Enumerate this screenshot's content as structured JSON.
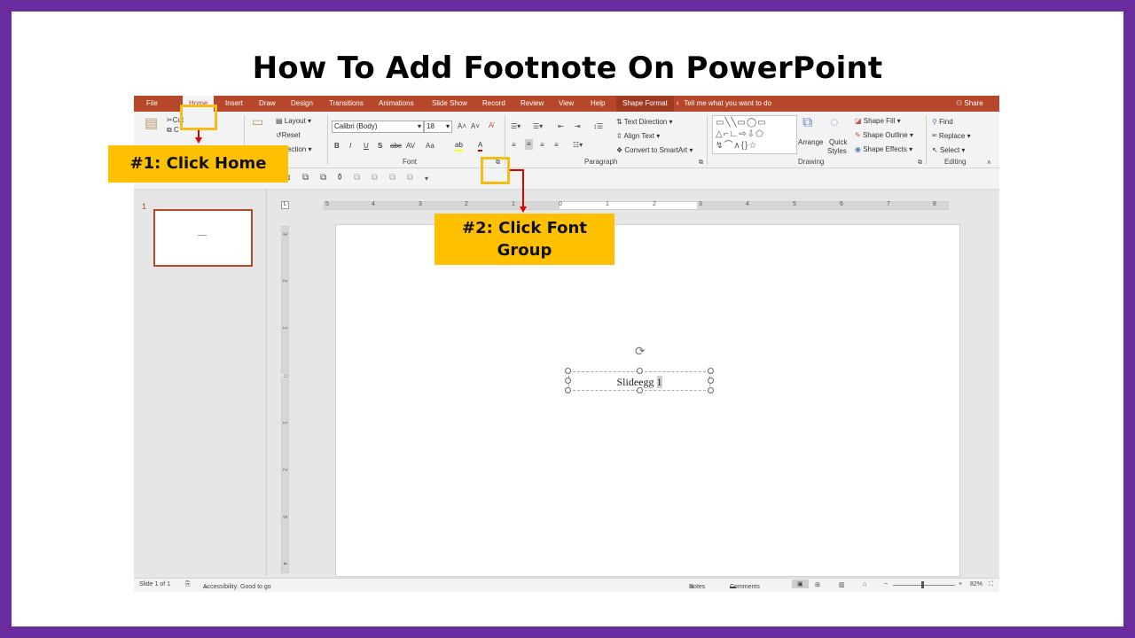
{
  "title": "How To Add Footnote On PowerPoint",
  "tabs": [
    "File",
    "Home",
    "Insert",
    "Draw",
    "Design",
    "Transitions",
    "Animations",
    "Slide Show",
    "Record",
    "Review",
    "View",
    "Help",
    "Shape Format"
  ],
  "tell_me": "Tell me what you want to do",
  "share": "Share",
  "clipboard": {
    "cut": "Cut",
    "copy": "C",
    "label": "es"
  },
  "slides_group": {
    "layout": "Layout",
    "reset": "Reset",
    "section": "Section"
  },
  "font": {
    "name": "Calibri (Body)",
    "size": "18",
    "label": "Font",
    "bold": "B",
    "italic": "I",
    "underline": "U",
    "shadow": "S",
    "strike": "abc",
    "spacing": "AV",
    "case": "Aa"
  },
  "paragraph": {
    "label": "Paragraph",
    "text_direction": "Text Direction",
    "align_text": "Align Text",
    "smartart": "Convert to SmartArt"
  },
  "drawing": {
    "label": "Drawing",
    "arrange": "Arrange",
    "quick_styles_1": "Quick",
    "quick_styles_2": "Styles",
    "shape_fill": "Shape Fill",
    "shape_outline": "Shape Outline",
    "shape_effects": "Shape Effects"
  },
  "editing": {
    "label": "Editing",
    "find": "Find",
    "replace": "Replace",
    "select": "Select"
  },
  "thumbnail_number": "1",
  "ruler_h": [
    "5",
    "4",
    "3",
    "2",
    "1",
    "0",
    "1",
    "2",
    "3",
    "4",
    "5",
    "6",
    "7",
    "8"
  ],
  "ruler_v": [
    "3",
    "2",
    "1",
    "0",
    "1",
    "2",
    "3",
    "4"
  ],
  "textbox": {
    "text": "Slideegg ",
    "selected": "1"
  },
  "status": {
    "slide": "Slide 1 of 1",
    "accessibility": "Accessibility: Good to go",
    "notes": "Notes",
    "comments": "Comments",
    "zoom": "82%"
  },
  "annotations": {
    "step1": "#1: Click Home",
    "step2_line1": "#2: Click Font",
    "step2_line2": "Group"
  },
  "colors": {
    "frame": "#6b2d9e",
    "ribbon": "#b7472a",
    "callout": "#fec000",
    "highlight": "#f6bd16",
    "arrow": "#e00000"
  }
}
